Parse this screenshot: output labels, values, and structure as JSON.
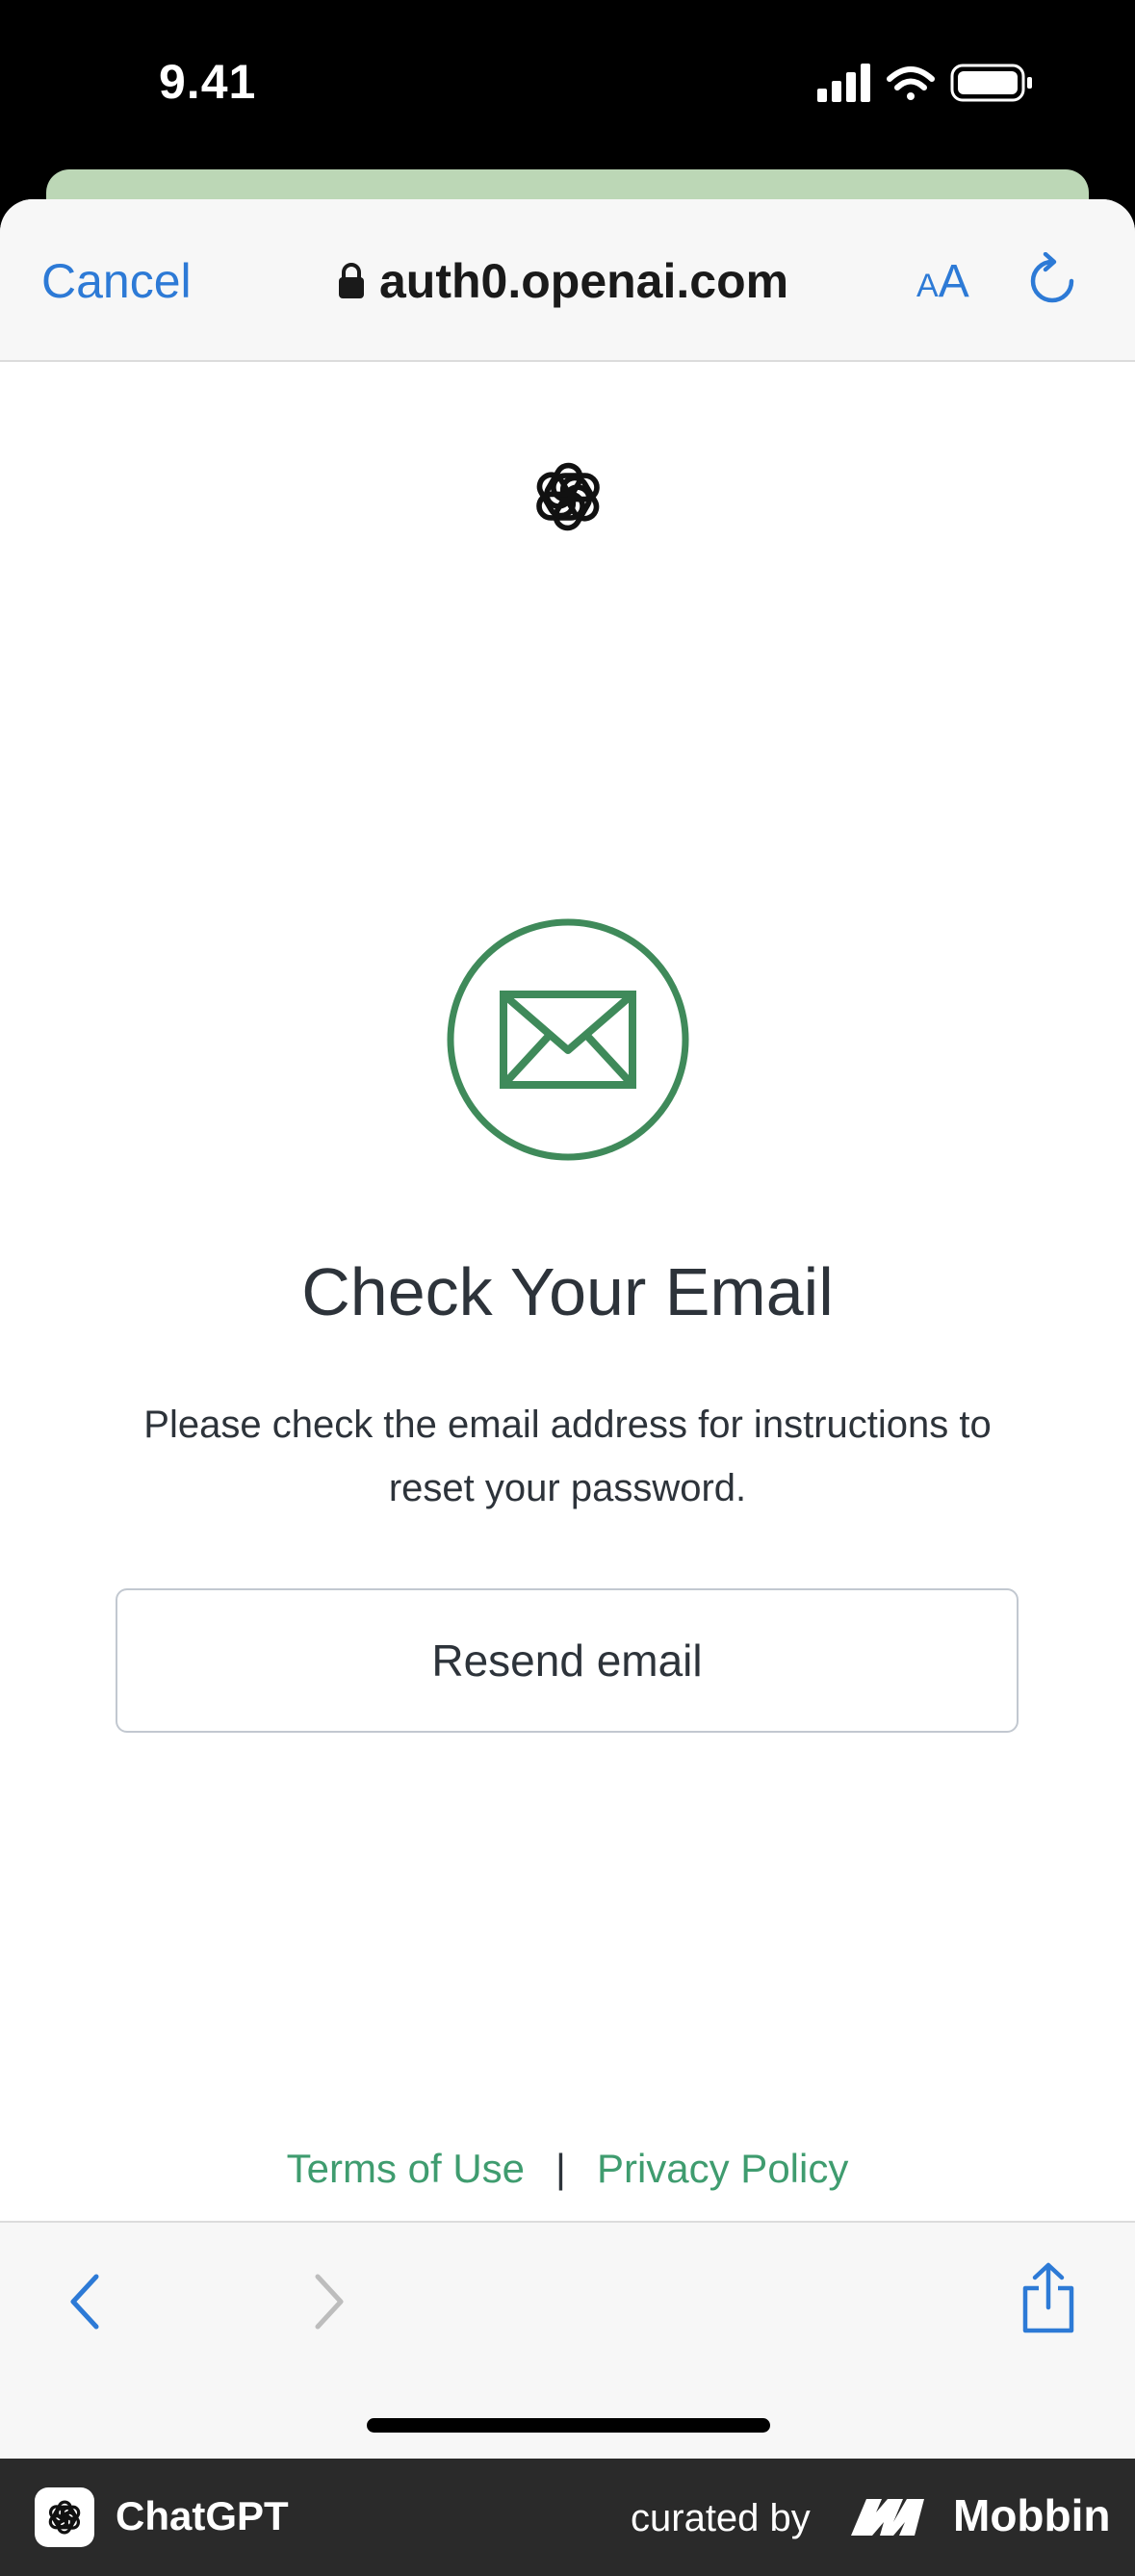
{
  "status_bar": {
    "time": "9.41"
  },
  "browser": {
    "cancel_label": "Cancel",
    "url": "auth0.openai.com",
    "text_size_small": "A",
    "text_size_large": "A"
  },
  "page": {
    "heading": "Check Your Email",
    "description": "Please check the email address for instructions to reset your password.",
    "resend_label": "Resend email",
    "terms_label": "Terms of Use",
    "separator": "|",
    "privacy_label": "Privacy Policy"
  },
  "colors": {
    "accent_green": "#3f8a5a",
    "link_green": "#3f9c6f",
    "ios_blue": "#2d7ad6"
  },
  "watermark": {
    "app_name": "ChatGPT",
    "curated_by": "curated by",
    "brand": "Mobbin"
  }
}
